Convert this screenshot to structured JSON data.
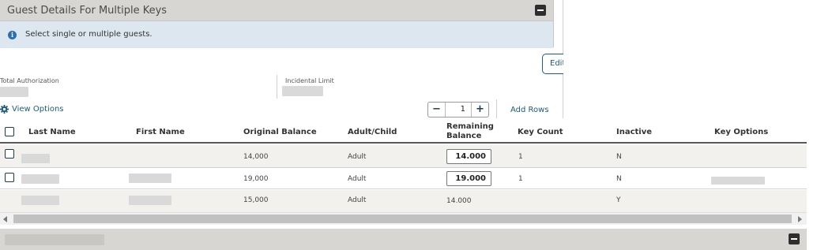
{
  "panel": {
    "title": "Guest Details For Multiple Keys",
    "collapse_icon": "minus-square-icon"
  },
  "info": {
    "icon": "info-circle-icon",
    "icon_glyph": "i",
    "message": "Select single or multiple guests."
  },
  "edit_label": "Edit",
  "fields": {
    "total_authorization_label": "Total Authorization",
    "incidental_limit_label": "Incidental Limit"
  },
  "toolbar": {
    "view_options_label": "View Options",
    "view_options_icon": "gear-icon",
    "decrement": "−",
    "quantity": "1",
    "increment": "+",
    "add_rows_label": "Add Rows"
  },
  "grid": {
    "columns": [
      "Last Name",
      "First Name",
      "Original Balance",
      "Adult/Child",
      "Remaining Balance",
      "Key Count",
      "Inactive",
      "Key Options"
    ],
    "rows": [
      {
        "original_balance": "14,000",
        "adult_child": "Adult",
        "remaining_balance": "14.000",
        "key_count": "1",
        "inactive": "N"
      },
      {
        "original_balance": "19,000",
        "adult_child": "Adult",
        "remaining_balance": "19.000",
        "key_count": "1",
        "inactive": "N"
      },
      {
        "original_balance": "15,000",
        "adult_child": "Adult",
        "remaining_balance": "14.000",
        "key_count": "",
        "inactive": "Y"
      }
    ]
  },
  "colors": {
    "header_bg": "#d8d6d2",
    "info_bg": "#dde7f0",
    "link": "#1e5c7a",
    "info_icon": "#2a6fb0"
  }
}
